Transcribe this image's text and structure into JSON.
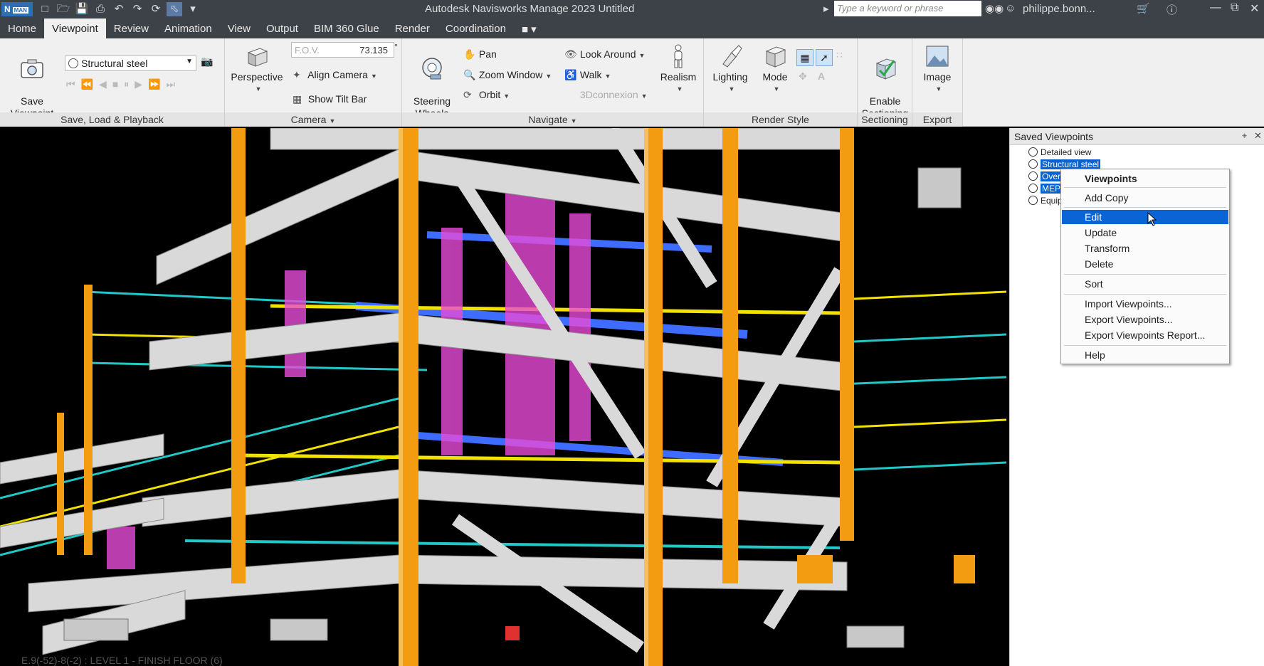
{
  "titlebar": {
    "logo": "N",
    "logo_sub": "MAN",
    "app_title": "Autodesk Navisworks Manage 2023    Untitled",
    "search_placeholder": "Type a keyword or phrase",
    "user": "philippe.bonn..."
  },
  "menu": {
    "tabs": [
      "Home",
      "Viewpoint",
      "Review",
      "Animation",
      "View",
      "Output",
      "BIM 360 Glue",
      "Render",
      "Coordination"
    ],
    "active": "Viewpoint"
  },
  "ribbon": {
    "save_load": {
      "title": "Save, Load & Playback",
      "save_viewpoint": "Save\nViewpoint",
      "current_viewpoint": "Structural steel"
    },
    "camera": {
      "title": "Camera",
      "perspective": "Perspective",
      "fov_label": "F.O.V.",
      "fov_value": "73.135",
      "fov_unit": "°",
      "align_camera": "Align Camera",
      "show_tilt_bar": "Show Tilt Bar"
    },
    "navigate": {
      "title": "Navigate",
      "steering_wheels": "Steering\nWheels",
      "pan": "Pan",
      "zoom_window": "Zoom Window",
      "orbit": "Orbit",
      "look_around": "Look Around",
      "walk": "Walk",
      "threed_connexion": "3Dconnexion",
      "realism": "Realism"
    },
    "render_style": {
      "title": "Render Style",
      "lighting": "Lighting",
      "mode": "Mode"
    },
    "sectioning": {
      "title": "Sectioning",
      "enable": "Enable\nSectioning"
    },
    "export": {
      "title": "Export",
      "image": "Image"
    }
  },
  "viewport": {
    "status": "E.9(-52)-8(-2) : LEVEL 1 - FINISH FLOOR (6)"
  },
  "saved_viewpoints": {
    "title": "Saved Viewpoints",
    "items": [
      "Detailed view",
      "Structural steel",
      "Over",
      "MEP",
      "Equip"
    ]
  },
  "context_menu": {
    "header": "Viewpoints",
    "items": [
      "Add Copy",
      "Edit",
      "Update",
      "Transform",
      "Delete",
      "Sort",
      "Import Viewpoints...",
      "Export Viewpoints...",
      "Export Viewpoints Report...",
      "Help"
    ],
    "highlighted": "Edit"
  },
  "colors": {
    "chrome_dark": "#3d4148",
    "ribbon_bg": "#f0f0f0",
    "selection_blue": "#0a64d6",
    "steel_orange": "#f39c12",
    "beam_grey": "#d9d9d9"
  }
}
